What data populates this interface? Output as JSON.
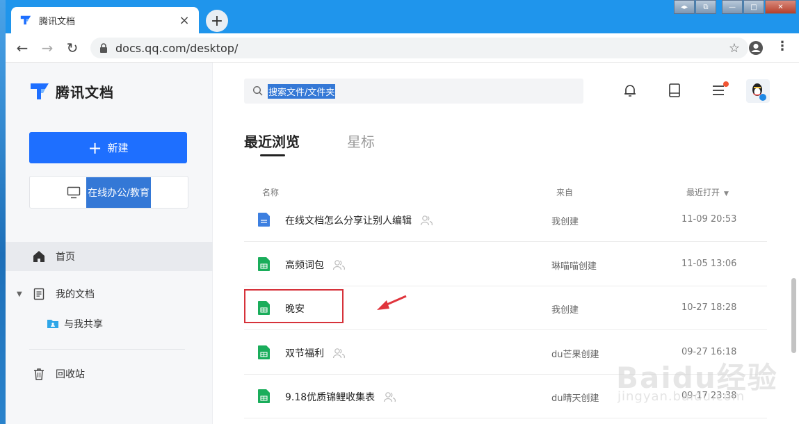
{
  "browser": {
    "tab_title": "腾讯文档",
    "tab_close": "×",
    "new_tab": "+",
    "url": "docs.qq.com/desktop/",
    "window_controls": {
      "restore_label": "◂▸",
      "snap_label": "⧉",
      "minimize_label": "—",
      "maximize_label": "□",
      "close_label": "✕"
    },
    "back": "←",
    "forward": "→",
    "reload": "↻",
    "bookmark": "☆",
    "menu": "⋮"
  },
  "sidebar": {
    "brand": "腾讯文档",
    "new_button": {
      "icon": "+",
      "label": "新建"
    },
    "online_button": {
      "label": "在线办公/教育"
    },
    "nav": [
      {
        "label": "首页",
        "icon": "home-icon",
        "active": true
      },
      {
        "label": "我的文档",
        "icon": "document-icon",
        "expanded": true,
        "toggle": "▼"
      },
      {
        "label": "与我共享",
        "icon": "shared-folder-icon"
      },
      {
        "label": "回收站",
        "icon": "trash-icon"
      }
    ]
  },
  "main": {
    "search_placeholder": "搜索文件/文件夹",
    "tabs": [
      {
        "label": "最近浏览",
        "active": true
      },
      {
        "label": "星标",
        "active": false
      }
    ],
    "columns": {
      "name": "名称",
      "source": "来自",
      "opened": "最近打开",
      "sort_indicator": "▼"
    },
    "files": [
      {
        "name": "在线文档怎么分享让别人编辑",
        "type": "doc",
        "shared": true,
        "source": "我创建",
        "time": "11-09 20:53"
      },
      {
        "name": "高频词包",
        "type": "sheet",
        "shared": true,
        "source": "琳喵喵创建",
        "time": "11-05 13:06"
      },
      {
        "name": "晚安",
        "type": "sheet",
        "shared": false,
        "source": "我创建",
        "time": "10-27 18:28",
        "highlighted": true
      },
      {
        "name": "双节福利",
        "type": "sheet",
        "shared": true,
        "source": "du芒果创建",
        "time": "09-27 16:18"
      },
      {
        "name": "9.18优质锦鲤收集表",
        "type": "sheet",
        "shared": true,
        "source": "du晴天创建",
        "time": "09-17 23:38"
      }
    ]
  },
  "colors": {
    "accent": "#1e6fff",
    "tabbar": "#1f95ec",
    "sheet_green": "#1aad5b",
    "doc_blue": "#3d7fe0",
    "highlight_red": "#d6323a",
    "notification_dot": "#f15533"
  },
  "watermark": {
    "brand": "Baidu经验",
    "domain": "jingyan.baidu.com"
  }
}
